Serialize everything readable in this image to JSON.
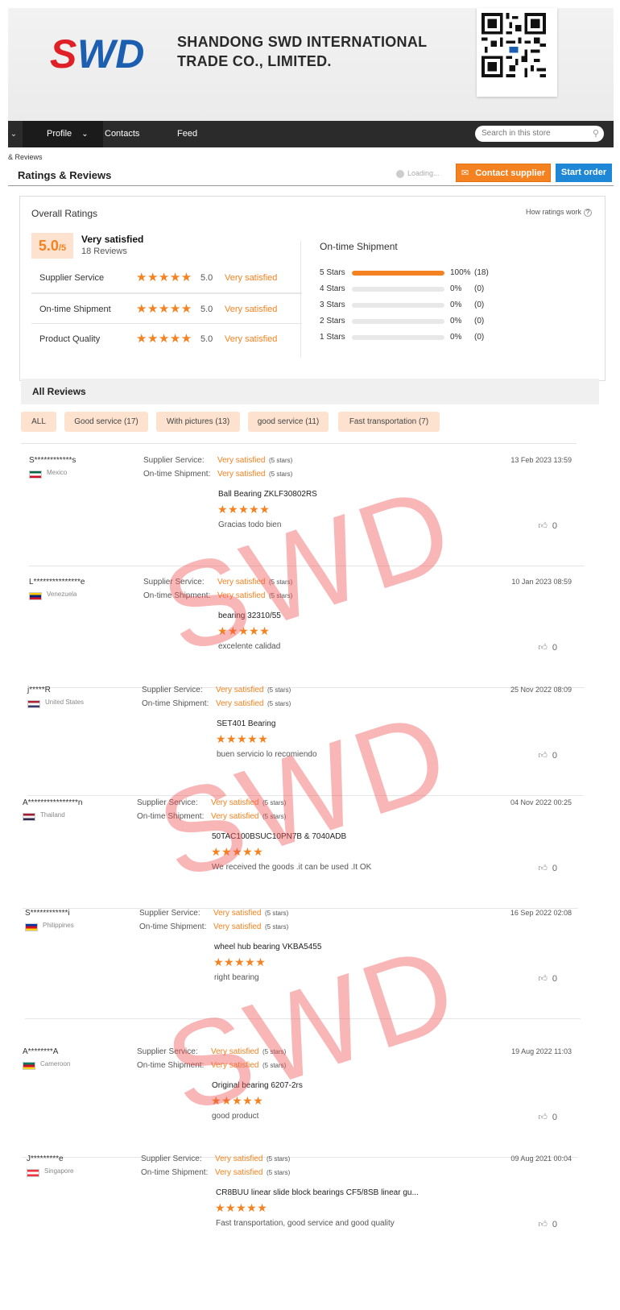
{
  "header": {
    "company_line1": "SHANDONG SWD INTERNATIONAL",
    "company_line2": "TRADE CO., LIMITED.",
    "logo_text": "SWD"
  },
  "nav": {
    "profile": "Profile",
    "contacts": "Contacts",
    "feed": "Feed",
    "search_placeholder": "Search in this store"
  },
  "breadcrumb": "& Reviews",
  "page_title": "Ratings & Reviews",
  "loading_text": "Loading...",
  "buttons": {
    "contact": "Contact supplier",
    "order": "Start order"
  },
  "overall": {
    "title": "Overall Ratings",
    "how_link": "How ratings work",
    "score": "5.0",
    "score_max": "/5",
    "verdict": "Very satisfied",
    "review_count": "18 Reviews",
    "metrics": [
      {
        "name": "Supplier Service",
        "value": "5.0",
        "label": "Very satisfied"
      },
      {
        "name": "On-time Shipment",
        "value": "5.0",
        "label": "Very satisfied"
      },
      {
        "name": "Product Quality",
        "value": "5.0",
        "label": "Very satisfied"
      }
    ],
    "distribution_title": "On-time Shipment",
    "distribution": [
      {
        "label": "5 Stars",
        "pct_text": "100%",
        "count": "(18)",
        "fraction": 1.0
      },
      {
        "label": "4 Stars",
        "pct_text": "0%",
        "count": "(0)",
        "fraction": 0
      },
      {
        "label": "3 Stars",
        "pct_text": "0%",
        "count": "(0)",
        "fraction": 0
      },
      {
        "label": "2 Stars",
        "pct_text": "0%",
        "count": "(0)",
        "fraction": 0
      },
      {
        "label": "1 Stars",
        "pct_text": "0%",
        "count": "(0)",
        "fraction": 0
      }
    ]
  },
  "all_reviews": {
    "title": "All Reviews",
    "filters": [
      "ALL",
      "Good service (17)",
      "With pictures (13)",
      "good service (11)",
      "Fast transportation (7)"
    ]
  },
  "review_labels": {
    "supplier_service": "Supplier Service:",
    "on_time": "On-time Shipment:",
    "very_satisfied": "Very satisfied",
    "five_stars": "(5 stars)",
    "stars": "★★★★★"
  },
  "reviews": [
    {
      "user": "S************s",
      "country": "Mexico",
      "date": "13 Feb 2023 13:59",
      "product": "Ball Bearing ZKLF30802RS",
      "comment": "Gracias todo bien",
      "likes": "0"
    },
    {
      "user": "L***************e",
      "country": "Venezuela",
      "date": "10 Jan 2023 08:59",
      "product": "bearing 32310/55",
      "comment": "excelente calidad",
      "likes": "0"
    },
    {
      "user": "j*****R",
      "country": "United States",
      "date": "25 Nov 2022 08:09",
      "product": "SET401 Bearing",
      "comment": "buen servicio lo recomiendo",
      "likes": "0"
    },
    {
      "user": "A****************n",
      "country": "Thailand",
      "date": "04 Nov 2022 00:25",
      "product": "50TAC100BSUC10PN7B & 7040ADB",
      "comment": "We received the goods .it can be used .It OK",
      "likes": "0"
    },
    {
      "user": "S************i",
      "country": "Philippines",
      "date": "16 Sep 2022 02:08",
      "product": "wheel hub bearing VKBA5455",
      "comment": "right bearing",
      "likes": "0"
    },
    {
      "user": "A********A",
      "country": "Cameroon",
      "date": "19 Aug 2022 11:03",
      "product": "Original bearing 6207-2rs",
      "comment": "good product",
      "likes": "0"
    },
    {
      "user": "J*********e",
      "country": "Singapore",
      "date": "09 Aug 2021 00:04",
      "product": "CR8BUU linear slide block bearings CF5/8SB linear gu...",
      "comment": "Fast transportation, good service and good quality",
      "likes": "0"
    }
  ],
  "watermark": "SWD",
  "colors": {
    "accent": "#f58220",
    "primary_blue": "#1e88d6",
    "nav_bg": "#2b2b2b",
    "logo_red": "#e02027",
    "logo_blue": "#1c5fb0"
  }
}
